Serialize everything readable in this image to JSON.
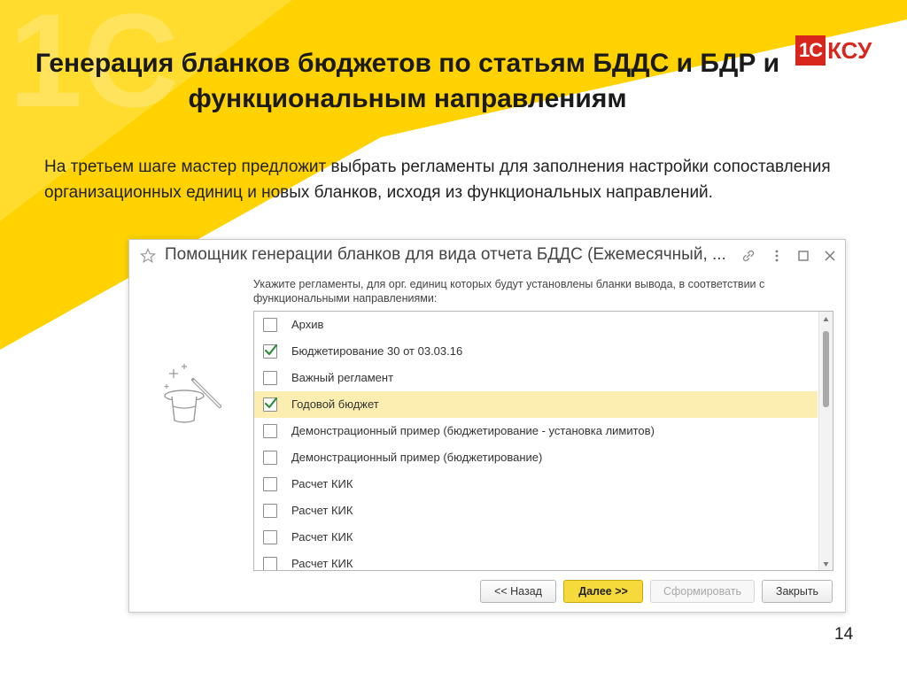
{
  "slide": {
    "title": "Генерация бланков бюджетов по статьям БДДС и БДР и функциональным направлениям",
    "description": "На третьем шаге мастер предложит выбрать регламенты для заполнения настройки сопоставления организационных единиц и новых бланков, исходя из функциональных направлений.",
    "page_number": "14",
    "logo": {
      "box_text": "1С",
      "text": "КСУ"
    }
  },
  "colors": {
    "accent_yellow": "#ffd200",
    "logo_red": "#d9261c",
    "selected_row": "#fbeeb0",
    "primary_button": "#f6d93a"
  },
  "window": {
    "title": "Помощник генерации бланков для вида отчета БДДС (Ежемесячный, ...",
    "hint": "Укажите регламенты, для орг. единиц которых будут установлены бланки вывода, в соответствии с функциональными направлениями:",
    "icons": [
      "star-icon",
      "link-icon",
      "more-icon",
      "maximize-icon",
      "close-icon",
      "magic-hat-icon"
    ],
    "items": [
      {
        "label": "Архив",
        "checked": false
      },
      {
        "label": "Бюджетирование 30 от 03.03.16",
        "checked": true
      },
      {
        "label": "Важный регламент",
        "checked": false
      },
      {
        "label": "Годовой бюджет",
        "checked": true
      },
      {
        "label": "Демонстрационный пример (бюджетирование - установка лимитов)",
        "checked": false
      },
      {
        "label": "Демонстрационный пример (бюджетирование)",
        "checked": false
      },
      {
        "label": "Расчет КИК",
        "checked": false
      },
      {
        "label": "Расчет КИК",
        "checked": false
      },
      {
        "label": "Расчет КИК",
        "checked": false
      },
      {
        "label": "Расчет КИК",
        "checked": false
      }
    ],
    "selected_index": 3,
    "buttons": {
      "back": "<< Назад",
      "next": "Далее >>",
      "generate": "Сформировать",
      "close": "Закрыть"
    }
  }
}
